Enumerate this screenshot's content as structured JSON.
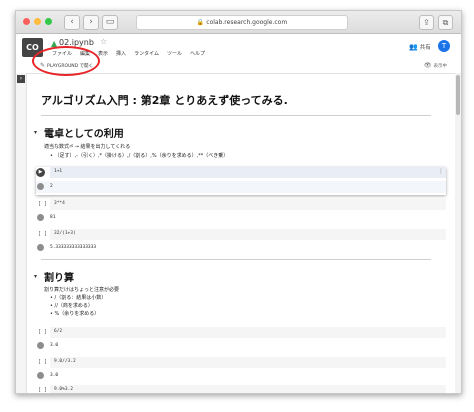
{
  "browser": {
    "url": "colab.research.google.com"
  },
  "header": {
    "logo": "CO",
    "filename": "02.ipynb",
    "menu": [
      "ファイル",
      "編集",
      "表示",
      "挿入",
      "ランタイム",
      "ツール",
      "ヘルプ"
    ],
    "share_label": "共有",
    "avatar_letter": "T"
  },
  "toolbar": {
    "playground_label": "PLAYGROUND で開く",
    "view_mode_label": "表示中"
  },
  "colors": {
    "highlight_circle": "#e8262a",
    "avatar": "#1a73e8"
  },
  "notebook": {
    "title": "アルゴリズム入門 : 第2章 とりあえず使ってみる.",
    "section1": {
      "heading": "電卓としての利用",
      "intro": "適当な数式⏎ → 結果を出力してくれる",
      "bullet": "（足す）,-（引く）,*（掛ける）,/（割る）,%（余りを求める）,**（べき乗）"
    },
    "cells1": [
      {
        "bracket": "",
        "code": "1+1",
        "output": "2"
      },
      {
        "bracket": "[ ]",
        "code": "3**4",
        "output": "81"
      },
      {
        "bracket": "[ ]",
        "code": "32/(1+3)",
        "output": "5.333333333333333"
      }
    ],
    "section2": {
      "heading": "割り算",
      "intro": "割り算だけはちょっと注意が必要",
      "bullets": [
        "/（割る：結果は小数）",
        "//（商を求める）",
        "%（余りを求める）"
      ]
    },
    "cells2": [
      {
        "bracket": "[ ]",
        "code": "6/2",
        "output": "3.0"
      },
      {
        "bracket": "[ ]",
        "code": "9.0//3.2",
        "output": "3.0"
      },
      {
        "bracket": "[ ]",
        "code": "9.0%3.2",
        "output": ""
      }
    ]
  }
}
